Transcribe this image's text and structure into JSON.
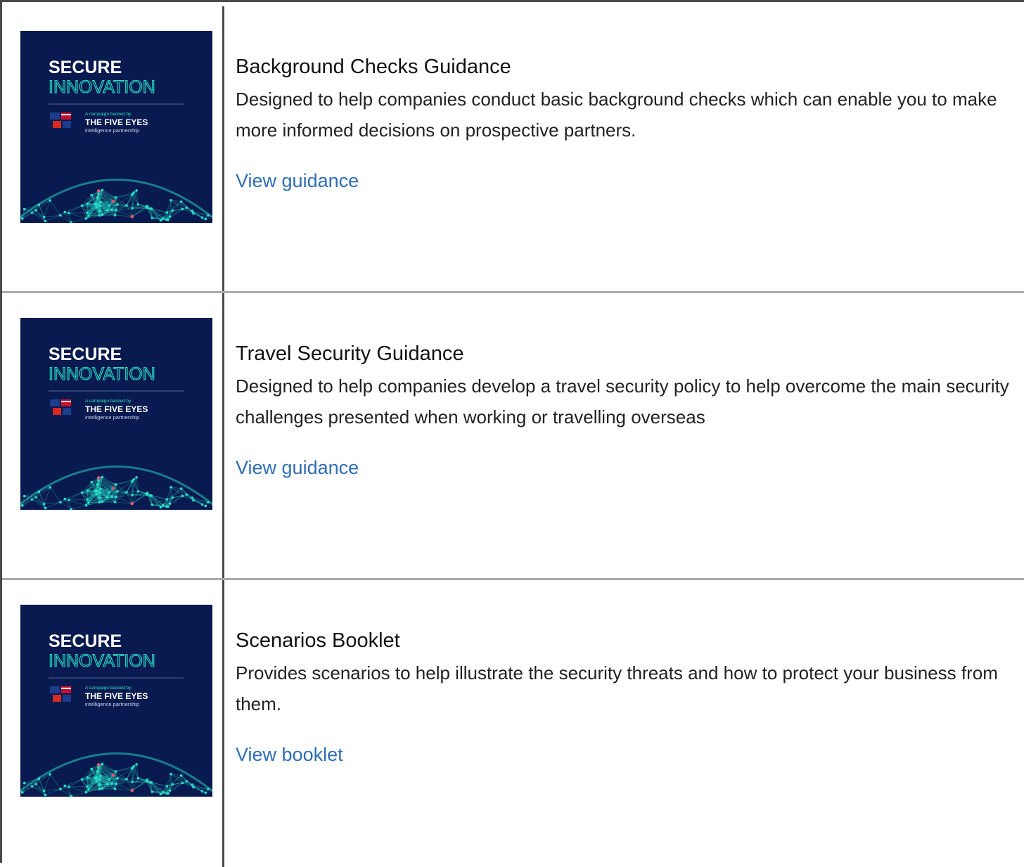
{
  "thumbnail": {
    "title_line1": "SECURE",
    "title_line2": "INNOVATION",
    "campaign_line": "A campaign backed by",
    "partner_name": "THE FIVE EYES",
    "partner_sub": "intelligence partnership",
    "colors": {
      "background": "#081a4f",
      "accent": "#28e0c8"
    }
  },
  "items": [
    {
      "title": "Background Checks Guidance",
      "description": "Designed to help companies conduct basic background checks which can enable you to make more informed decisions on prospective partners.",
      "link": "View guidance"
    },
    {
      "title": "Travel Security Guidance",
      "description": "Designed to help companies develop a travel security policy to help overcome the main security challenges presented when working or travelling overseas",
      "link": "View guidance"
    },
    {
      "title": "Scenarios Booklet",
      "description": "Provides scenarios to help illustrate the security threats and how to protect your business from them.",
      "link": "View booklet"
    }
  ]
}
